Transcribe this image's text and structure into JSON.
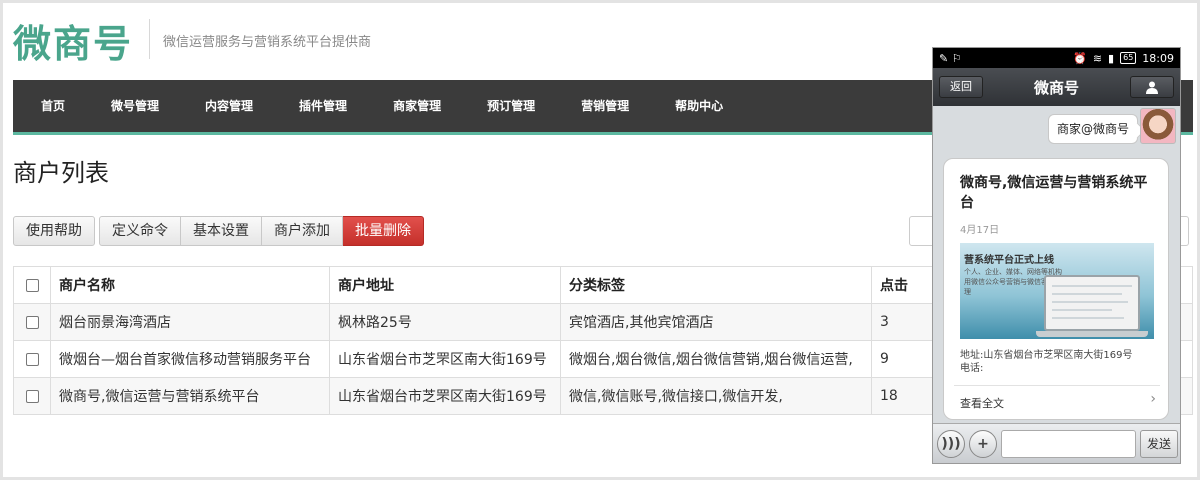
{
  "header": {
    "logo": "微商号",
    "tagline": "微信运营服务与营销系统平台提供商"
  },
  "nav": {
    "items": [
      "首页",
      "微号管理",
      "内容管理",
      "插件管理",
      "商家管理",
      "预订管理",
      "营销管理",
      "帮助中心"
    ]
  },
  "page": {
    "title": "商户列表"
  },
  "toolbar": {
    "help_label": "使用帮助",
    "define_command_label": "定义命令",
    "basic_settings_label": "基本设置",
    "add_merchant_label": "商户添加",
    "batch_delete_label": "批量删除"
  },
  "table": {
    "headers": [
      "商户名称",
      "商户地址",
      "分类标签",
      "点击"
    ],
    "rows": [
      {
        "name": "烟台丽景海湾酒店",
        "address": "枫林路25号",
        "tags": "宾馆酒店,其他宾馆酒店",
        "clicks": "3"
      },
      {
        "name": "微烟台—烟台首家微信移动营销服务平台",
        "address": "山东省烟台市芝罘区南大街169号",
        "tags": "微烟台,烟台微信,烟台微信营销,烟台微信运营,",
        "clicks": "9"
      },
      {
        "name": "微商号,微信运营与营销系统平台",
        "address": "山东省烟台市芝罘区南大街169号",
        "tags": "微信,微信账号,微信接口,微信开发,",
        "clicks": "18"
      }
    ]
  },
  "phone": {
    "status": {
      "time": "18:09",
      "battery": "65"
    },
    "title": "微商号",
    "back_label": "返回",
    "bubble": "商家@微商号",
    "card": {
      "title": "微商号,微信运营与营销系统平台",
      "date": "4月17日",
      "image_text": "营系统平台正式上线",
      "image_sub": "个人、企业、媒体、网络等机构 用微信公众号营销与微信客服管理",
      "address": "地址:山东省烟台市芝罘区南大街169号",
      "phone": "电话:",
      "more": "查看全文"
    },
    "send_label": "发送"
  },
  "colors": {
    "brand": "#4aa58c",
    "nav_bg": "#3b3b3b",
    "nav_accent": "#5cb8a0",
    "danger": "#c4302b"
  }
}
